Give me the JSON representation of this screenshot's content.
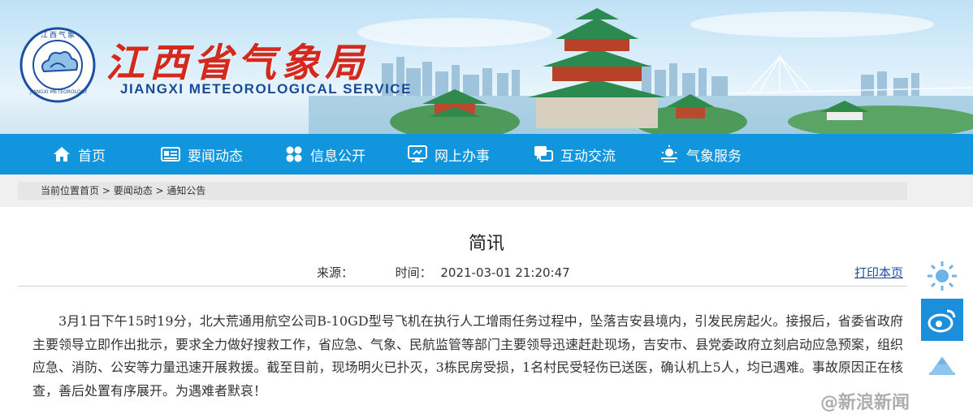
{
  "header": {
    "brand_cn": "江西省气象局",
    "brand_en": "JIANGXI METEOROLOGICAL SERVICE",
    "logo_top_text": "江西气象",
    "logo_bottom_text": "JIANGXI METEOROLOGY",
    "colors": {
      "brand_red": "#d42a1e",
      "brand_blue": "#174b9a"
    }
  },
  "nav": {
    "color": "#1196de",
    "items": [
      {
        "label": "首页",
        "icon": "home-icon"
      },
      {
        "label": "要闻动态",
        "icon": "news-icon"
      },
      {
        "label": "信息公开",
        "icon": "grid-icon"
      },
      {
        "label": "网上办事",
        "icon": "monitor-icon"
      },
      {
        "label": "互动交流",
        "icon": "chat-icon"
      },
      {
        "label": "气象服务",
        "icon": "weather-icon"
      }
    ]
  },
  "breadcrumb": {
    "prefix": "当前位置",
    "items": [
      "首页",
      "要闻动态",
      "通知公告"
    ],
    "separator": " > "
  },
  "article": {
    "title": "简讯",
    "source_label": "来源：",
    "time_label": "时间：",
    "time_value": "2021-03-01 21:20:47",
    "print_label": "打印本页",
    "body": "3月1日下午15时19分，北大荒通用航空公司B-10GD型号飞机在执行人工增雨任务过程中，坠落吉安县境内，引发民房起火。接报后，省委省政府主要领导立即作出批示，要求全力做好搜救工作，省应急、气象、民航监管等部门主要领导迅速赶赴现场，吉安市、县党委政府立刻启动应急预案，组织应急、消防、公安等力量迅速开展救援。截至目前，现场明火已扑灭，3栋民房受损，1名村民受轻伤已送医，确认机上5人，均已遇难。事故原因正在核查，善后处置有序展开。为遇难者默哀！"
  },
  "side_widgets": [
    {
      "icon": "sun-icon"
    },
    {
      "icon": "weibo-icon"
    },
    {
      "icon": "mountain-icon"
    }
  ],
  "watermark": {
    "text": "@新浪新闻"
  }
}
